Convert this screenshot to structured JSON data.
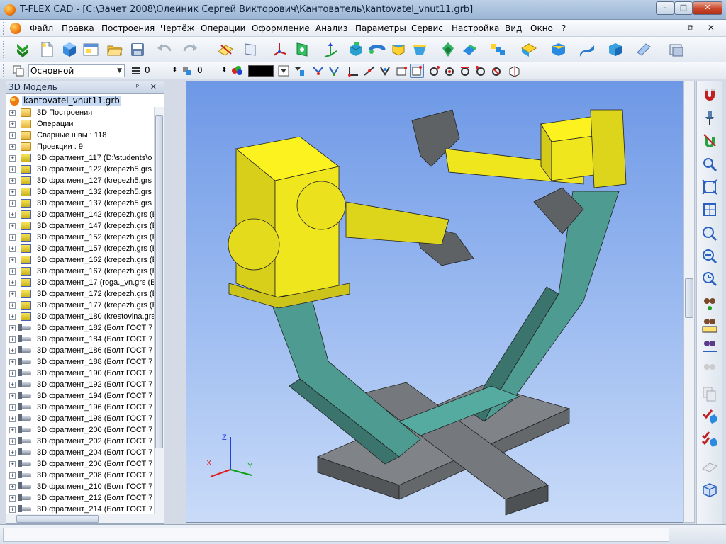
{
  "window": {
    "title": "T-FLEX CAD - [C:\\Зачет 2008\\Олейник Сергей Викторович\\Кантователь\\kantovatel_vnut11.grb]",
    "min_label": "–",
    "max_label": "□",
    "close_label": "✕"
  },
  "menu": {
    "items": [
      "Файл",
      "Правка",
      "Построения",
      "Чертёж",
      "Операции",
      "Оформление",
      "Анализ",
      "Параметры",
      "Сервис",
      "Настройка",
      "Вид",
      "Окно",
      "?"
    ],
    "mdi_controls": "– ⧉ ✕"
  },
  "toolbar2": {
    "layer": "Основной",
    "level": "0",
    "priority": "0",
    "color": "#000000"
  },
  "tree": {
    "panel_title": "3D Модель",
    "header_buttons": "ᵖ ✕",
    "root": "kantovatel_vnut11.grb",
    "items": [
      {
        "icon": "folder",
        "label": "3D Построения"
      },
      {
        "icon": "folder",
        "label": "Операции"
      },
      {
        "icon": "folder",
        "label": "Сварные швы : 118"
      },
      {
        "icon": "folder",
        "label": "Проекции : 9"
      },
      {
        "icon": "frag",
        "label": "3D фрагмент_117 (D:\\students\\o"
      },
      {
        "icon": "frag",
        "label": "3D фрагмент_122 (krepezh5.grs ("
      },
      {
        "icon": "frag",
        "label": "3D фрагмент_127 (krepezh5.grs ("
      },
      {
        "icon": "frag",
        "label": "3D фрагмент_132 (krepezh5.grs ("
      },
      {
        "icon": "frag",
        "label": "3D фрагмент_137 (krepezh5.grs ("
      },
      {
        "icon": "frag",
        "label": "3D фрагмент_142 (krepezh.grs (E"
      },
      {
        "icon": "frag",
        "label": "3D фрагмент_147 (krepezh.grs (E"
      },
      {
        "icon": "frag",
        "label": "3D фрагмент_152 (krepezh.grs (E"
      },
      {
        "icon": "frag",
        "label": "3D фрагмент_157 (krepezh.grs (E"
      },
      {
        "icon": "frag",
        "label": "3D фрагмент_162 (krepezh.grs (E"
      },
      {
        "icon": "frag",
        "label": "3D фрагмент_167 (krepezh.grs (E"
      },
      {
        "icon": "frag",
        "label": "3D фрагмент_17 (roga._vn.grs (B"
      },
      {
        "icon": "frag",
        "label": "3D фрагмент_172 (krepezh.grs (E"
      },
      {
        "icon": "frag",
        "label": "3D фрагмент_177 (krepezh.grs (E"
      },
      {
        "icon": "frag",
        "label": "3D фрагмент_180 (krestovina.grs"
      },
      {
        "icon": "bolt",
        "label": "3D фрагмент_182 (Болт ГОСТ 7"
      },
      {
        "icon": "bolt",
        "label": "3D фрагмент_184 (Болт ГОСТ 7"
      },
      {
        "icon": "bolt",
        "label": "3D фрагмент_186 (Болт ГОСТ 7"
      },
      {
        "icon": "bolt",
        "label": "3D фрагмент_188 (Болт ГОСТ 7"
      },
      {
        "icon": "bolt",
        "label": "3D фрагмент_190 (Болт ГОСТ 7"
      },
      {
        "icon": "bolt",
        "label": "3D фрагмент_192 (Болт ГОСТ 7"
      },
      {
        "icon": "bolt",
        "label": "3D фрагмент_194 (Болт ГОСТ 7"
      },
      {
        "icon": "bolt",
        "label": "3D фрагмент_196 (Болт ГОСТ 7"
      },
      {
        "icon": "bolt",
        "label": "3D фрагмент_198 (Болт ГОСТ 7"
      },
      {
        "icon": "bolt",
        "label": "3D фрагмент_200 (Болт ГОСТ 7"
      },
      {
        "icon": "bolt",
        "label": "3D фрагмент_202 (Болт ГОСТ 7"
      },
      {
        "icon": "bolt",
        "label": "3D фрагмент_204 (Болт ГОСТ 7"
      },
      {
        "icon": "bolt",
        "label": "3D фрагмент_206 (Болт ГОСТ 7"
      },
      {
        "icon": "bolt",
        "label": "3D фрагмент_208 (Болт ГОСТ 7"
      },
      {
        "icon": "bolt",
        "label": "3D фрагмент_210 (Болт ГОСТ 7"
      },
      {
        "icon": "bolt",
        "label": "3D фрагмент_212 (Болт ГОСТ 7"
      },
      {
        "icon": "bolt",
        "label": "3D фрагмент_214 (Болт ГОСТ 7"
      }
    ]
  },
  "viewport": {
    "axis_x": "X",
    "axis_y": "Y",
    "axis_z": "Z",
    "colors": {
      "gearbox": "#f0e61e",
      "frame": "#4e9b91",
      "base": "#6f7377",
      "axis_x": "#e02020",
      "axis_y": "#10a010",
      "axis_z": "#2040e0"
    }
  },
  "statusbar": {
    "text": ""
  }
}
